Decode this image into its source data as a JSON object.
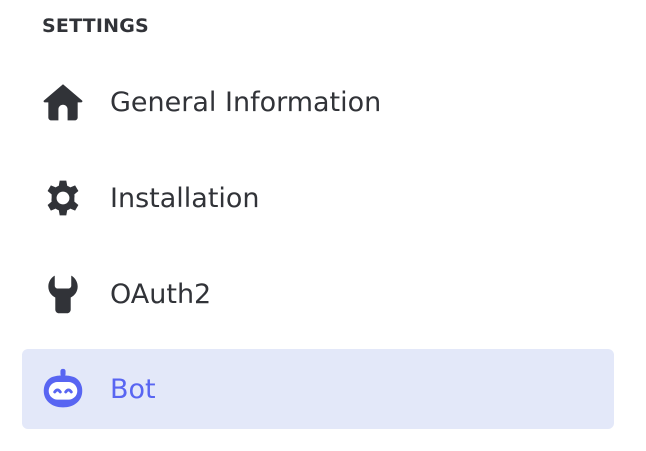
{
  "sidebar": {
    "section_title": "SETTINGS",
    "items": [
      {
        "label": "General Information",
        "icon": "home-icon",
        "active": false
      },
      {
        "label": "Installation",
        "icon": "gear-icon",
        "active": false
      },
      {
        "label": "OAuth2",
        "icon": "wrench-icon",
        "active": false
      },
      {
        "label": "Bot",
        "icon": "bot-icon",
        "active": true
      }
    ]
  },
  "colors": {
    "text": "#313338",
    "accent": "#5865f2",
    "active_background": "#e3e8f9",
    "background": "#ffffff"
  }
}
